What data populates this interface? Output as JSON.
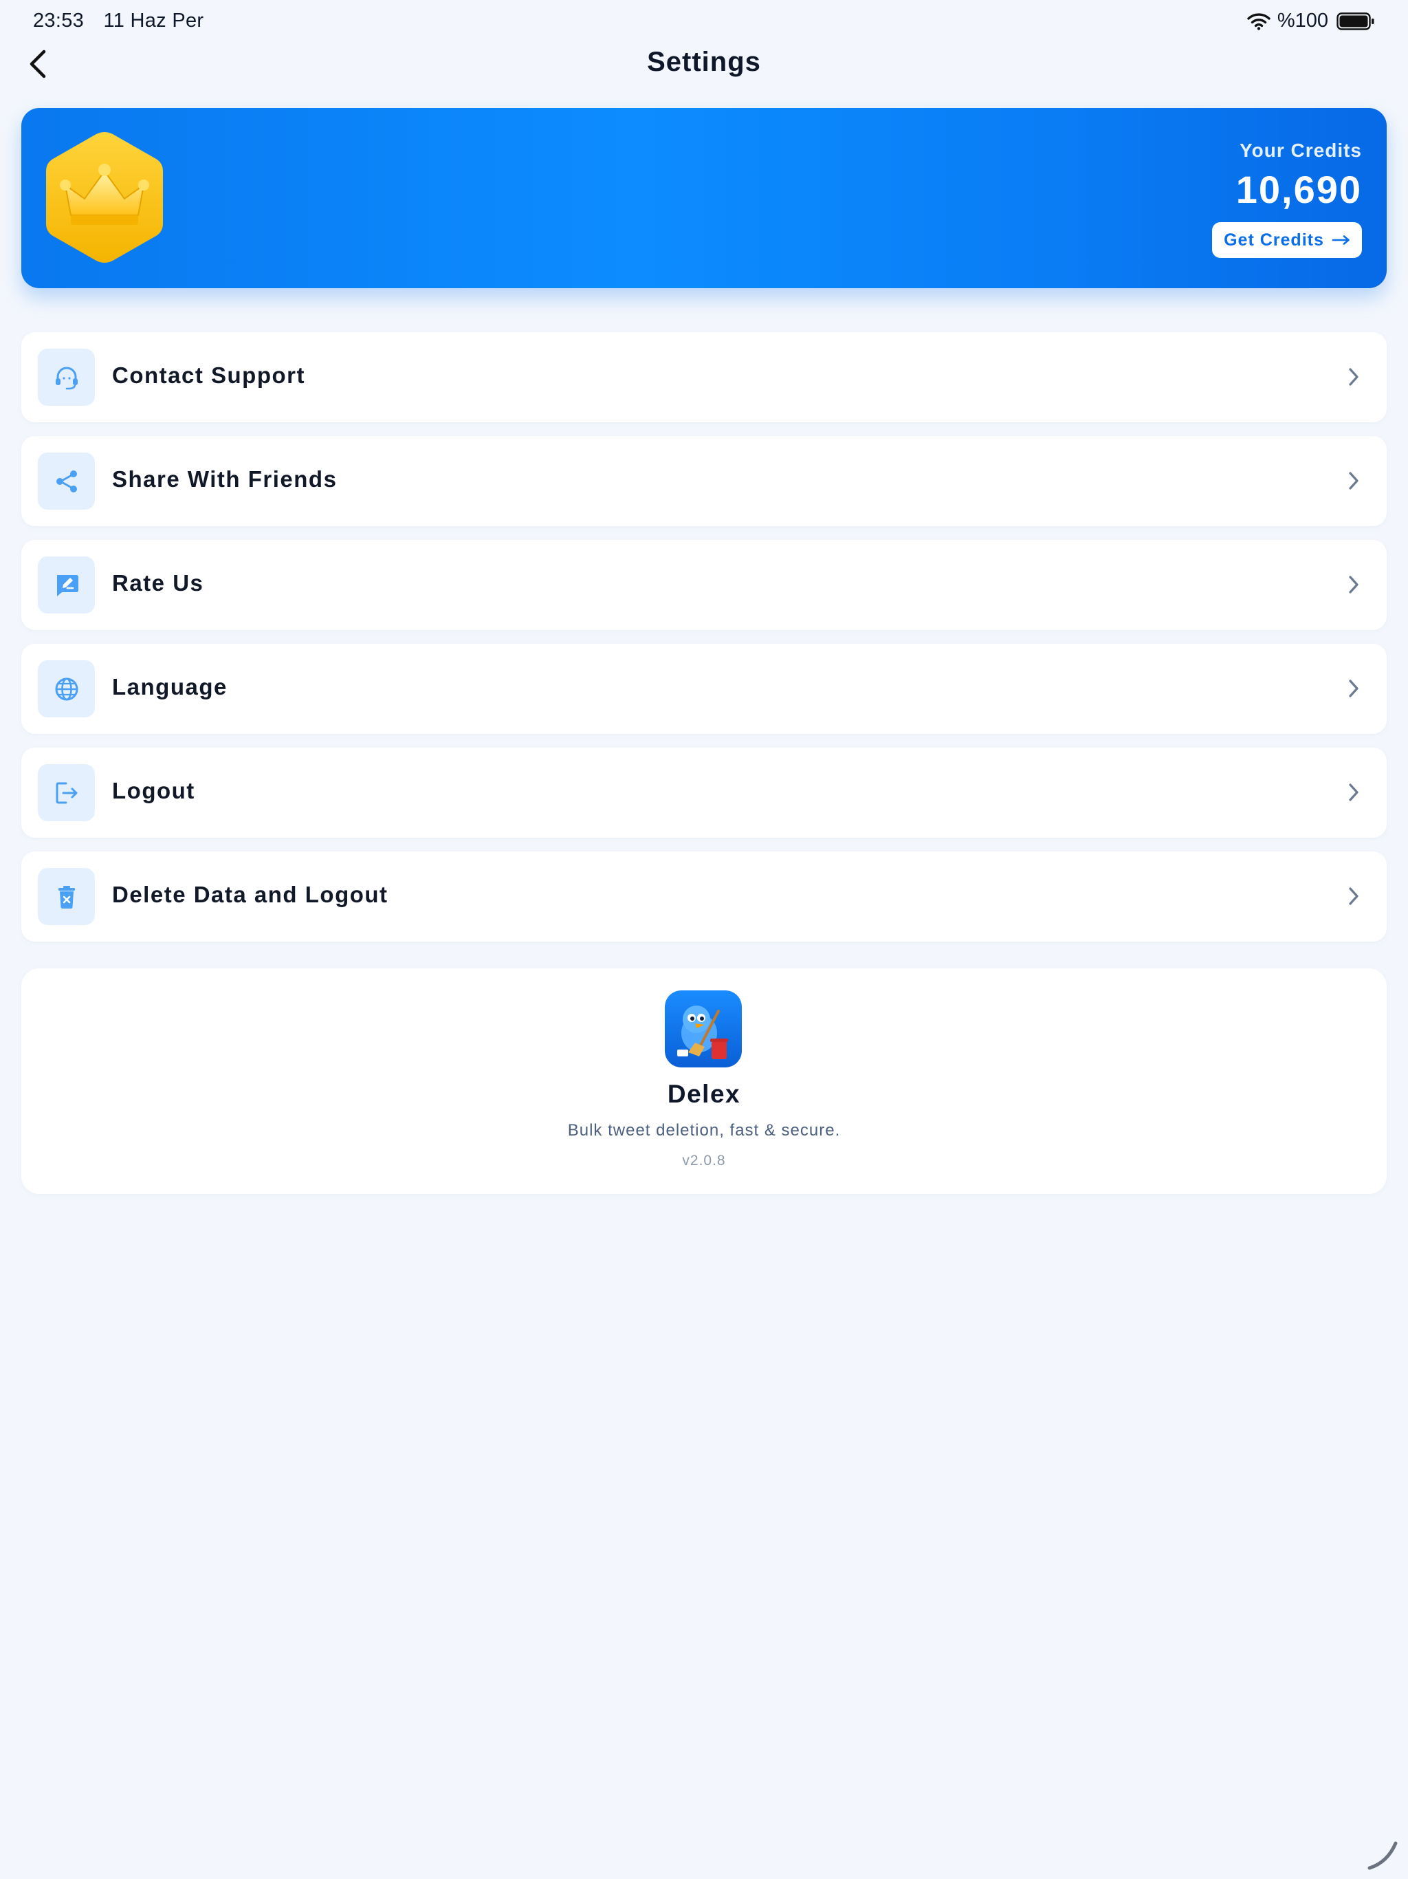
{
  "status_bar": {
    "time": "23:53",
    "date": "11 Haz Per",
    "battery": "%100",
    "icons": [
      "wifi-icon",
      "battery-icon"
    ]
  },
  "nav": {
    "title": "Settings",
    "back_icon": "chevron-left-icon"
  },
  "credits": {
    "label": "Your Credits",
    "value": "10,690",
    "button_label": "Get Credits",
    "badge_icon": "crown-icon",
    "colors": {
      "card": "#0c8cff",
      "badge": "#fcc419",
      "button_text": "#0a6fe8"
    }
  },
  "menu": {
    "items": [
      {
        "label": "Contact Support",
        "icon": "headset-icon"
      },
      {
        "label": "Share With Friends",
        "icon": "share-icon"
      },
      {
        "label": "Rate Us",
        "icon": "rate-icon"
      },
      {
        "label": "Language",
        "icon": "globe-icon"
      },
      {
        "label": "Logout",
        "icon": "logout-icon"
      },
      {
        "label": "Delete Data and Logout",
        "icon": "trash-icon"
      }
    ],
    "icon_color": "#4aa0f5",
    "chevron_icon": "chevron-right-icon"
  },
  "about": {
    "app_name": "Delex",
    "tagline": "Bulk tweet deletion, fast & secure.",
    "version": "v2.0.8"
  }
}
